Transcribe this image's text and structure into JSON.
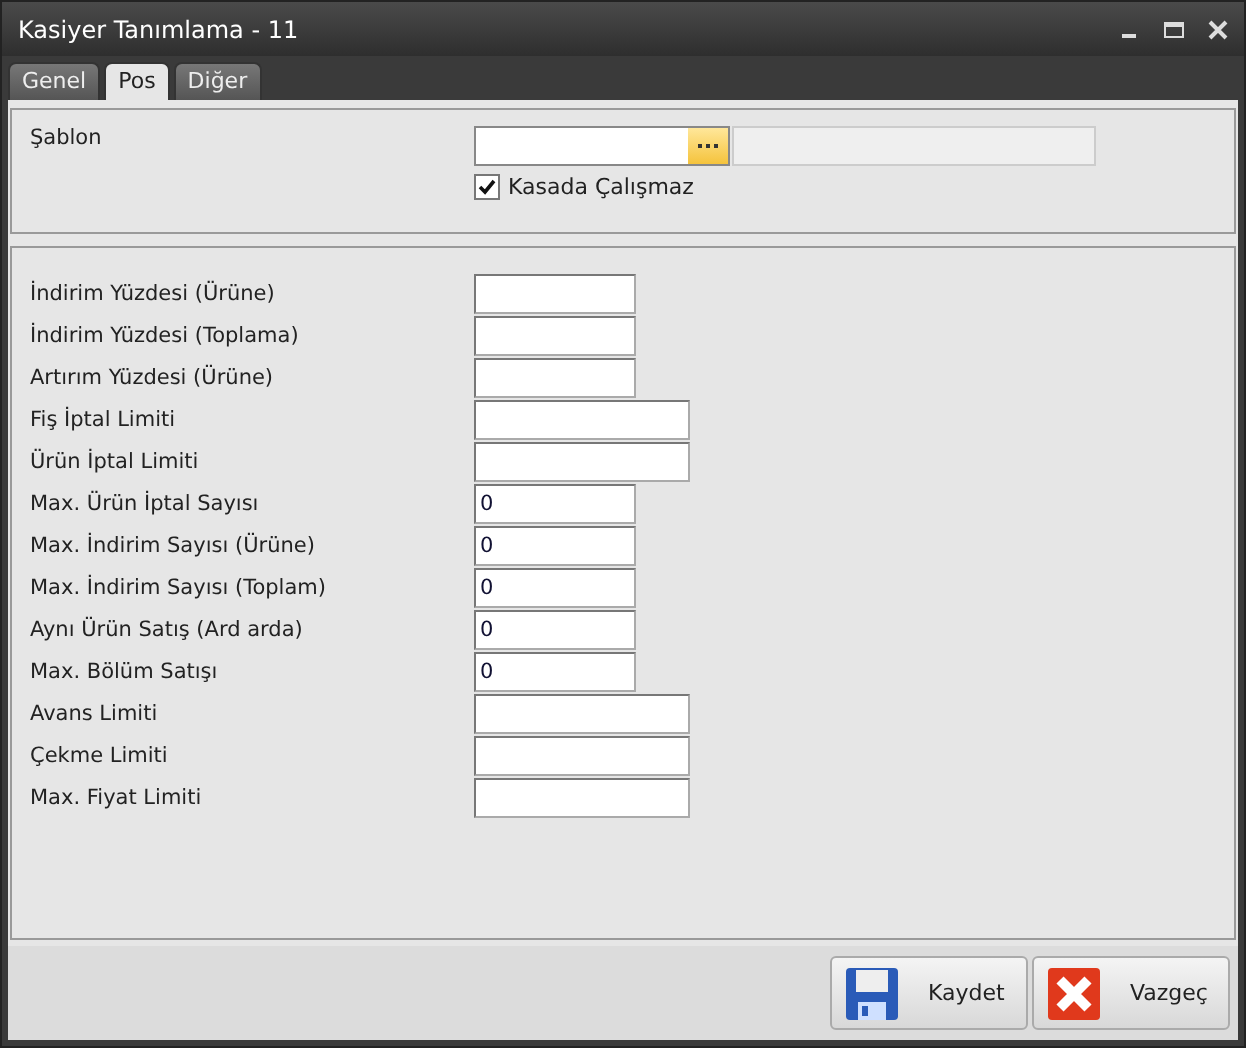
{
  "window": {
    "title": "Kasiyer Tanımlama - 11"
  },
  "tabs": [
    {
      "label": "Genel",
      "selected": false
    },
    {
      "label": "Pos",
      "selected": true
    },
    {
      "label": "Diğer",
      "selected": false
    }
  ],
  "template": {
    "label": "Şablon",
    "checkbox": {
      "label": "Kasada Çalışmaz",
      "checked": true
    }
  },
  "fields": [
    {
      "label": "İndirim Yüzdesi (Ürüne)",
      "kind": "short"
    },
    {
      "label": "İndirim Yüzdesi (Toplama)",
      "kind": "short"
    },
    {
      "label": "Artırım Yüzdesi (Ürüne)",
      "kind": "short"
    },
    {
      "label": "Fiş İptal Limiti",
      "kind": "wide"
    },
    {
      "label": "Ürün İptal Limiti",
      "kind": "wide"
    },
    {
      "label": "Max. Ürün İptal Sayısı",
      "kind": "short",
      "value": "0"
    },
    {
      "label": "Max. İndirim Sayısı (Ürüne)",
      "kind": "short",
      "value": "0"
    },
    {
      "label": "Max. İndirim Sayısı (Toplam)",
      "kind": "short",
      "value": "0"
    },
    {
      "label": "Aynı Ürün Satış (Ard arda)",
      "kind": "short",
      "value": "0"
    },
    {
      "label": "Max. Bölüm Satışı",
      "kind": "short",
      "value": "0"
    },
    {
      "label": "Avans Limiti",
      "kind": "wide"
    },
    {
      "label": "Çekme Limiti",
      "kind": "wide"
    },
    {
      "label": "Max. Fiyat Limiti",
      "kind": "wide"
    }
  ],
  "buttons": [
    {
      "label": "Kaydet",
      "kind": "save"
    },
    {
      "label": "Vazgeç",
      "kind": "cancel"
    }
  ]
}
